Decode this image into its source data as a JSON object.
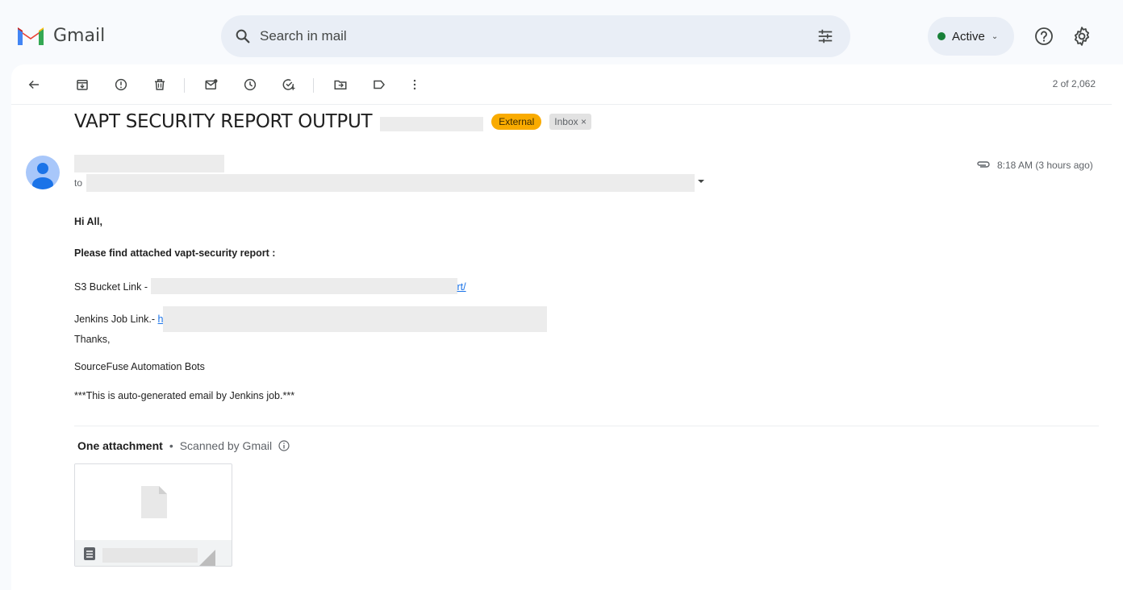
{
  "app": {
    "name": "Gmail"
  },
  "search": {
    "placeholder": "Search in mail"
  },
  "status": {
    "label": "Active",
    "color": "#188038"
  },
  "toolbar": {
    "count": "2 of 2,062"
  },
  "email": {
    "subject": "VAPT SECURITY REPORT OUTPUT",
    "labels": {
      "external": "External",
      "inbox": "Inbox",
      "inbox_close": "×"
    },
    "to_label": "to",
    "time": "8:18 AM (3 hours ago)",
    "body": {
      "greeting": "Hi All,",
      "intro": "Please find attached vapt-security report :",
      "s3_label": "S3 Bucket Link - ",
      "s3_link_tail": "rt/",
      "jenkins_label": "Jenkins Job Link.- ",
      "jenkins_link_head": "h",
      "thanks": "Thanks,",
      "signature": "SourceFuse Automation Bots",
      "footer": "***This is auto-generated email by Jenkins job.***"
    }
  },
  "attachments": {
    "title": "One attachment",
    "bullet": "•",
    "scanned": "Scanned by Gmail"
  },
  "colors": {
    "accent": "#1a73e8",
    "external_badge": "#f9ab00",
    "avatar": "#a8c7fa"
  }
}
